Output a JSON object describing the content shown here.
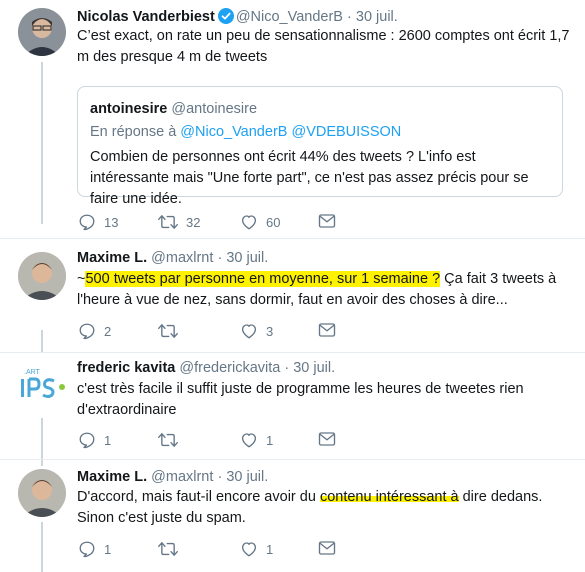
{
  "tweets": [
    {
      "name": "Nicolas Vanderbiest",
      "handle": "@Nico_VanderB",
      "sep": "·",
      "time": "30 juil.",
      "text": "C’est exact, on rate un peu de sensationnalisme : 2600 comptes ont écrit 1,7 m des presque 4 m de tweets",
      "quote": {
        "name": "antoinesire",
        "handle": "@antoinesire",
        "reply_prefix": "En réponse à",
        "reply_mentions": "@Nico_VanderB @VDEBUISSON",
        "text": "Combien de personnes ont écrit 44% des tweets ? L'info est intéressante mais \"Une forte part\", ce n'est pas assez précis pour se faire une idée."
      },
      "replies": "13",
      "retweets": "32",
      "likes": "60"
    },
    {
      "name": "Maxime L.",
      "handle": "@maxlrnt",
      "sep": "·",
      "time": "30 juil.",
      "text_pre": "~",
      "text_highlight": "500 tweets par personne en moyenne, sur 1 semaine ?",
      "text_post": " Ça fait 3 tweets à l'heure à vue de nez, sans dormir, faut en avoir des choses à dire...",
      "replies": "2",
      "retweets": "",
      "likes": "3"
    },
    {
      "name": "frederic kavita",
      "handle": "@frederickavita",
      "sep": "·",
      "time": "30 juil.",
      "text": "c'est très facile il suffit juste de programme les heures de tweetes rien d'extraordinaire",
      "replies": "1",
      "retweets": "",
      "likes": "1"
    },
    {
      "name": "Maxime L.",
      "handle": "@maxlrnt",
      "sep": "·",
      "time": "30 juil.",
      "text_pre": "D'accord, mais faut-il encore avoir du ",
      "text_highlight": "contenu intéressant à",
      "text_post": " dire dedans. Sinon c'est juste du spam.",
      "replies": "1",
      "retweets": "",
      "likes": "1"
    }
  ],
  "icons": {
    "reply": "reply-icon",
    "retweet": "retweet-icon",
    "like": "heart-icon",
    "dm": "envelope-icon",
    "verified": "verified-badge-icon"
  },
  "colors": {
    "verified": "#1da1f2",
    "highlight": "#fff200",
    "secondary": "#657786"
  }
}
